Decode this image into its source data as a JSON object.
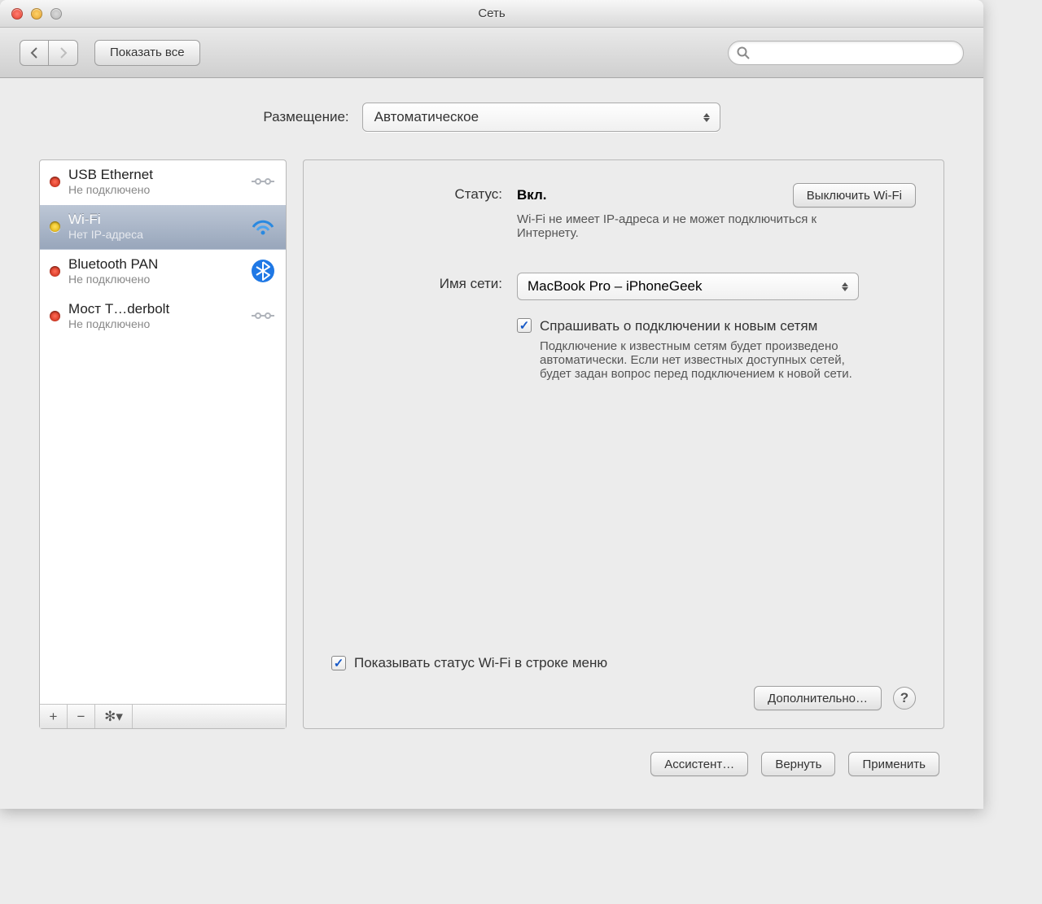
{
  "window": {
    "title": "Сеть"
  },
  "toolbar": {
    "show_all": "Показать все",
    "search_placeholder": ""
  },
  "location": {
    "label": "Размещение:",
    "value": "Автоматическое"
  },
  "sidebar": {
    "items": [
      {
        "name": "USB Ethernet",
        "status": "Не подключено",
        "dot": "red",
        "icon": "ethernet"
      },
      {
        "name": "Wi-Fi",
        "status": "Нет IP-адреса",
        "dot": "yellow",
        "icon": "wifi",
        "selected": true
      },
      {
        "name": "Bluetooth PAN",
        "status": "Не подключено",
        "dot": "red",
        "icon": "bluetooth"
      },
      {
        "name": "Мост T…derbolt",
        "status": "Не подключено",
        "dot": "red",
        "icon": "ethernet"
      }
    ],
    "add": "+",
    "remove": "−",
    "gear": "⚙"
  },
  "detail": {
    "status_label": "Статус:",
    "status_value": "Вкл.",
    "turn_off": "Выключить Wi-Fi",
    "status_note": "Wi-Fi не имеет IP-адреса и не может подключиться к Интернету.",
    "network_label": "Имя сети:",
    "network_value": "MacBook Pro – iPhoneGeek",
    "ask_label": "Спрашивать о подключении к новым сетям",
    "ask_desc": "Подключение к известным сетям будет произведено автоматически. Если нет известных доступных сетей, будет задан вопрос перед подключением к новой сети.",
    "menu_status": "Показывать статус Wi-Fi в строке меню",
    "advanced": "Дополнительно…"
  },
  "footer": {
    "assist": "Ассистент…",
    "revert": "Вернуть",
    "apply": "Применить"
  }
}
